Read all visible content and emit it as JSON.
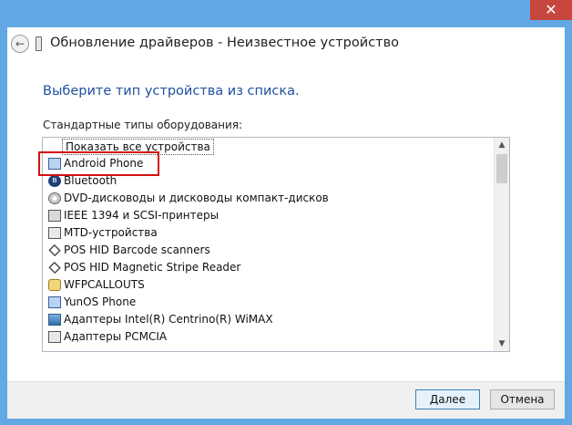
{
  "window": {
    "close_glyph": "✕"
  },
  "header": {
    "back_glyph": "←",
    "title": "Обновление драйверов - Неизвестное устройство"
  },
  "main": {
    "heading": "Выберите тип устройства из списка.",
    "list_label": "Стандартные типы оборудования:",
    "items": [
      {
        "label": "Показать все устройства",
        "icon": "none"
      },
      {
        "label": "Android Phone",
        "icon": "monitor-phone-icon"
      },
      {
        "label": "Bluetooth",
        "icon": "bluetooth-icon"
      },
      {
        "label": "DVD-дисководы и дисководы компакт-дисков",
        "icon": "disc-drive-icon"
      },
      {
        "label": "IEEE 1394 и SCSI-принтеры",
        "icon": "printer-icon"
      },
      {
        "label": "MTD-устройства",
        "icon": "card-icon"
      },
      {
        "label": "POS HID Barcode scanners",
        "icon": "diamond-device-icon"
      },
      {
        "label": "POS HID Magnetic Stripe Reader",
        "icon": "diamond-device-icon"
      },
      {
        "label": "WFPCALLOUTS",
        "icon": "gear-box-icon"
      },
      {
        "label": "YunOS Phone",
        "icon": "monitor-phone-icon"
      },
      {
        "label": "Адаптеры Intel(R) Centrino(R) WiMAX",
        "icon": "network-adapter-icon"
      },
      {
        "label": "Адаптеры PCMCIA",
        "icon": "card-icon"
      }
    ],
    "highlighted_item": "Android Phone"
  },
  "footer": {
    "next_label": "Далее",
    "cancel_label": "Отмена"
  },
  "colors": {
    "heading": "#1e4f9f",
    "highlight_border": "#d60f0f",
    "window_frame": "#62a8e5"
  }
}
